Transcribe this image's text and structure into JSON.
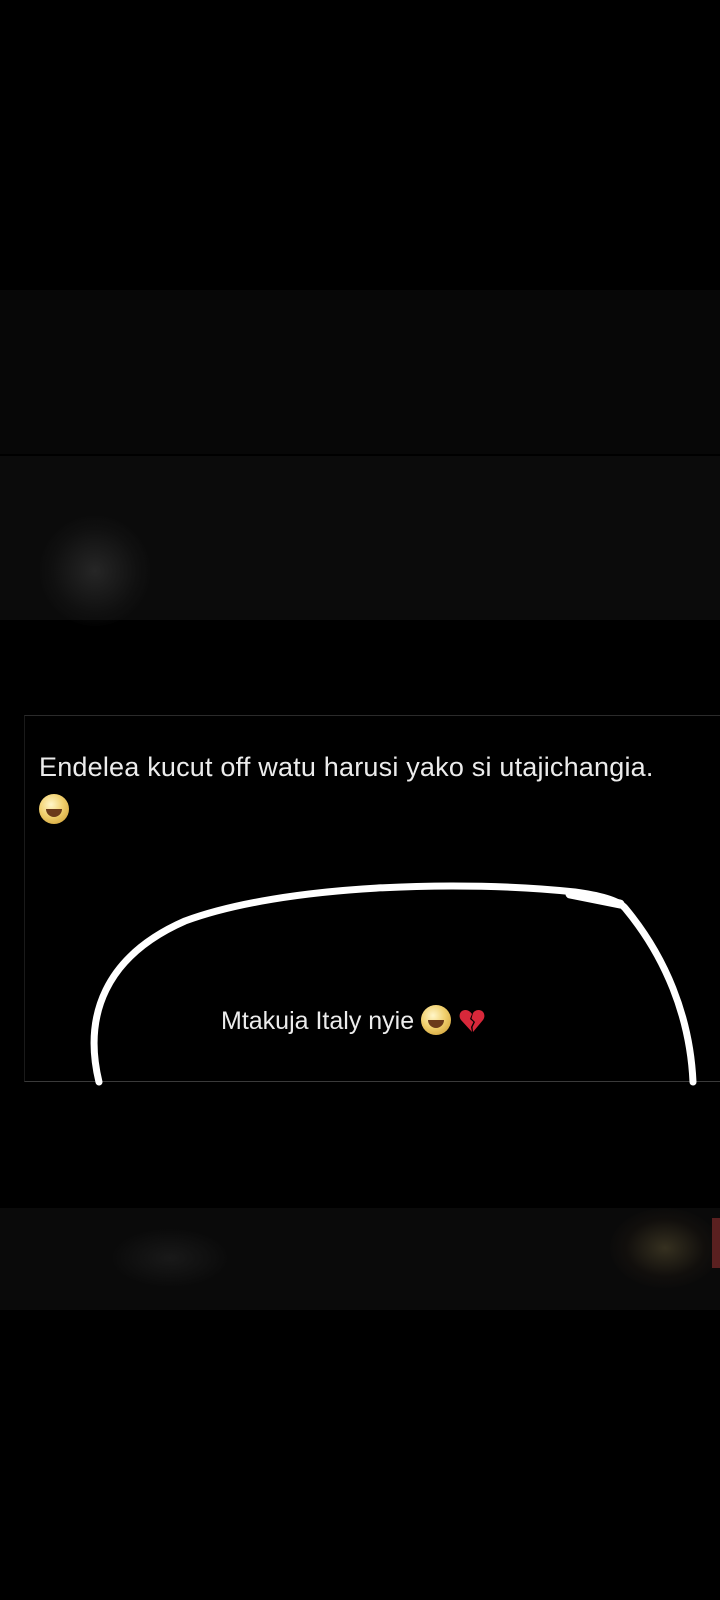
{
  "post": {
    "caption": "Endelea kucut off watu harusi yako si utajichangia.",
    "caption_emoji": "joy-emoji",
    "comment": "Mtakuja Italy nyie",
    "comment_emojis": [
      "joy-emoji",
      "broken-heart-emoji"
    ]
  },
  "colors": {
    "background": "#000000",
    "text": "#ececec",
    "annotation_stroke": "#ffffff",
    "broken_heart": "#d8283a"
  }
}
